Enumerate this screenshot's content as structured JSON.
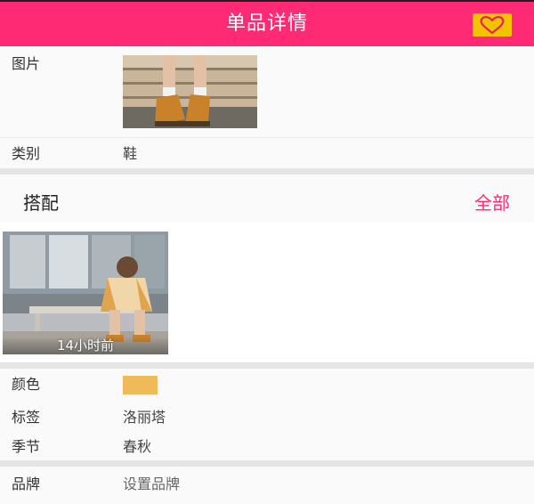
{
  "header": {
    "title": "单品详情",
    "favorite_icon": "heart-icon",
    "bar_color": "#ff2a73",
    "favorite_bg": "#f2c400"
  },
  "details": {
    "image_label": "图片",
    "category_label": "类别",
    "category_value": "鞋"
  },
  "outfits": {
    "title": "搭配",
    "all_link": "全部",
    "items": [
      {
        "time": "14小时前"
      }
    ]
  },
  "attributes": {
    "color_label": "颜色",
    "color_value": "#efba5a",
    "tag_label": "标签",
    "tag_value": "洛丽塔",
    "season_label": "季节",
    "season_value": "春秋"
  },
  "brand": {
    "label": "品牌",
    "value": "设置品牌"
  }
}
